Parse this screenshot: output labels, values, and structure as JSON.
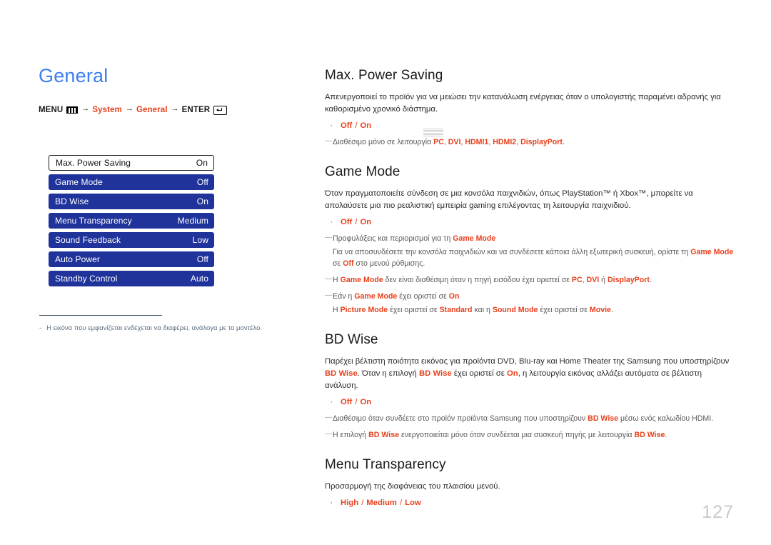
{
  "page": {
    "title": "General",
    "number": "127",
    "title_color": "#3b7ff0",
    "accent_color": "#e8401c",
    "osd_blue": "#1f339b"
  },
  "breadcrumb": {
    "menu_label": "MENU",
    "menu_icon": "menu-bars-icon",
    "arrow": "→",
    "step_system": "System",
    "step_general": "General",
    "enter_label": "ENTER",
    "enter_icon": "enter-return-icon"
  },
  "osd_menu": {
    "rows": [
      {
        "label": "Max. Power Saving",
        "value": "On",
        "selected": true
      },
      {
        "label": "Game Mode",
        "value": "Off",
        "selected": false
      },
      {
        "label": "BD Wise",
        "value": "On",
        "selected": false
      },
      {
        "label": "Menu Transparency",
        "value": "Medium",
        "selected": false
      },
      {
        "label": "Sound Feedback",
        "value": "Low",
        "selected": false
      },
      {
        "label": "Auto Power",
        "value": "Off",
        "selected": false
      },
      {
        "label": "Standby Control",
        "value": "Auto",
        "selected": false
      }
    ]
  },
  "left_footnote": {
    "dash": "-",
    "text": "Η εικόνα που εμφανίζεται ενδέχεται να διαφέρει, ανάλογα με το μοντέλο."
  },
  "sections": {
    "max_power_saving": {
      "title": "Max. Power Saving",
      "body": "Απενεργοποιεί το προϊόν για να μειώσει την κατανάλωση ενέργειας όταν ο υπολογιστής παραμένει αδρανής για καθορισμένο χρονικό διάστημα.",
      "options": {
        "bullet": "·",
        "opt1": "Off",
        "sep": "/",
        "opt2": "On"
      },
      "note1": {
        "dash": "—",
        "pre": "Διαθέσιμο μόνο σε λειτουργία ",
        "t1": "PC",
        "c1": ", ",
        "t2": "DVI",
        "c2": ", ",
        "t3": "HDMI1",
        "c3": ", ",
        "t4": "HDMI2",
        "c4": ", ",
        "t5": "DisplayPort",
        "post": "."
      }
    },
    "game_mode": {
      "title": "Game Mode",
      "body": "Όταν πραγματοποιείτε σύνδεση σε μια κονσόλα παιχνιδιών, όπως PlayStation™ ή Xbox™, μπορείτε να απολαύσετε μια πιο ρεαλιστική εμπειρία gaming επιλέγοντας τη λειτουργία παιχνιδιού.",
      "options": {
        "bullet": "·",
        "opt1": "Off",
        "sep": "/",
        "opt2": "On"
      },
      "note1": {
        "dash": "—",
        "pre": "Προφυλάξεις και περιορισμοί για τη ",
        "t1": "Game Mode"
      },
      "note1_sub": {
        "a": "Για να αποσυνδέσετε την κονσόλα παιχνιδιών και να συνδέσετε κάποια άλλη εξωτερική συσκευή, ορίστε τη ",
        "t1": "Game Mode",
        "b": " σε ",
        "t2": "Off",
        "c": " στο μενού ρύθμισης."
      },
      "note2": {
        "dash": "—",
        "a": "Η ",
        "t1": "Game Mode",
        "b": " δεν είναι διαθέσιμη όταν η πηγή εισόδου έχει οριστεί σε ",
        "t2": "PC",
        "c": ", ",
        "t3": "DVI",
        "d": " ή ",
        "t4": "DisplayPort",
        "e": "."
      },
      "note3": {
        "dash": "—",
        "a": "Εάν η ",
        "t1": "Game Mode",
        "b": " έχει οριστεί σε ",
        "t2": "On"
      },
      "note3_sub": {
        "a": "Η ",
        "t1": "Picture Mode",
        "b": " έχει οριστεί σε ",
        "t2": "Standard",
        "c": " και η ",
        "t3": "Sound Mode",
        "d": " έχει οριστεί σε ",
        "t4": "Movie",
        "e": "."
      }
    },
    "bd_wise": {
      "title": "BD Wise",
      "body_a": "Παρέχει βέλτιστη ποιότητα εικόνας για προϊόντα DVD, Blu-ray και Home Theater της Samsung που υποστηρίζουν ",
      "t1": "BD Wise",
      "body_b": ". Όταν η επιλογή ",
      "t2": "BD Wise",
      "body_c": " έχει οριστεί σε ",
      "t3": "On",
      "body_d": ", η λειτουργία εικόνας αλλάζει αυτόματα σε βέλτιστη ανάλυση.",
      "options": {
        "bullet": "·",
        "opt1": "Off",
        "sep": "/",
        "opt2": "On"
      },
      "note1": {
        "dash": "—",
        "a": "Διαθέσιμο όταν συνδέετε στο προϊόν προϊόντα Samsung που υποστηρίζουν ",
        "t1": "BD Wise",
        "b": " μέσω ενός καλωδίου HDMI."
      },
      "note2": {
        "dash": "—",
        "a": "Η επιλογή ",
        "t1": "BD Wise",
        "b": " ενεργοποιείται μόνο όταν συνδέεται μια συσκευή πηγής με λειτουργία ",
        "t2": "BD Wise",
        "c": "."
      }
    },
    "menu_transparency": {
      "title": "Menu Transparency",
      "body": "Προσαρμογή της διαφάνειας του πλαισίου μενού.",
      "options": {
        "bullet": "·",
        "opt1": "High",
        "sep1": "/",
        "opt2": "Medium",
        "sep2": "/",
        "opt3": "Low"
      }
    }
  }
}
